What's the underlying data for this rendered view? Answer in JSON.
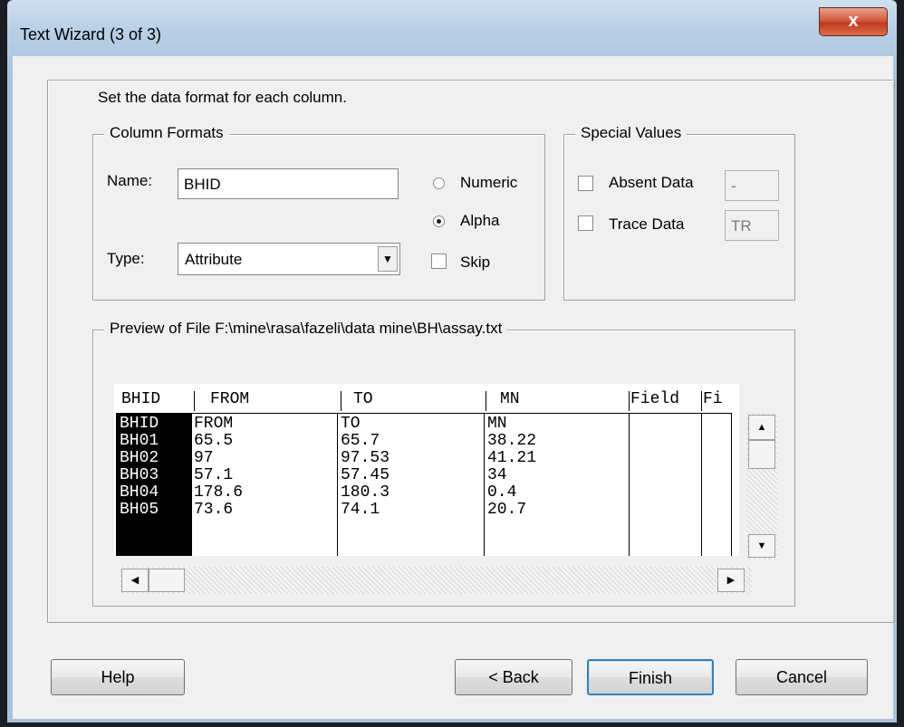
{
  "window": {
    "title": "Text Wizard (3 of 3)",
    "close_glyph": "x"
  },
  "intro": "Set the data format for each column.",
  "column_formats": {
    "legend": "Column Formats",
    "name_label": "Name:",
    "name_value": "BHID",
    "type_label": "Type:",
    "type_value": "Attribute",
    "numeric_label": "Numeric",
    "alpha_label": "Alpha",
    "skip_label": "Skip",
    "selected_format": "Alpha",
    "skip_checked": false
  },
  "special_values": {
    "legend": "Special Values",
    "absent_label": "Absent Data",
    "absent_value": "-",
    "trace_label": "Trace Data",
    "trace_value": "TR"
  },
  "preview": {
    "legend": "Preview of File F:\\mine\\rasa\\fazeli\\data mine\\BH\\assay.txt",
    "headers": [
      "BHID",
      "FROM",
      "TO",
      "MN",
      "Field",
      "Fi"
    ],
    "rows": [
      [
        "BHID",
        "FROM",
        "TO",
        "MN"
      ],
      [
        "BH01",
        "65.5",
        "65.7",
        "38.22"
      ],
      [
        "BH02",
        "97",
        "97.53",
        "41.21"
      ],
      [
        "BH03",
        "57.1",
        "57.45",
        "34"
      ],
      [
        "BH04",
        "178.6",
        "180.3",
        "0.4"
      ],
      [
        "BH05",
        "73.6",
        "74.1",
        "20.7"
      ]
    ]
  },
  "buttons": {
    "help": "Help",
    "back": "< Back",
    "finish": "Finish",
    "cancel": "Cancel"
  },
  "icons": {
    "combo_arrow": "dropdown-arrow-icon",
    "scroll_up": "scroll-up-icon",
    "scroll_down": "scroll-down-icon",
    "scroll_left": "scroll-left-icon",
    "scroll_right": "scroll-right-icon"
  },
  "colors": {
    "titlebar": "#b9cfe5",
    "close": "#c23a1c",
    "selected_column": "#000000"
  }
}
